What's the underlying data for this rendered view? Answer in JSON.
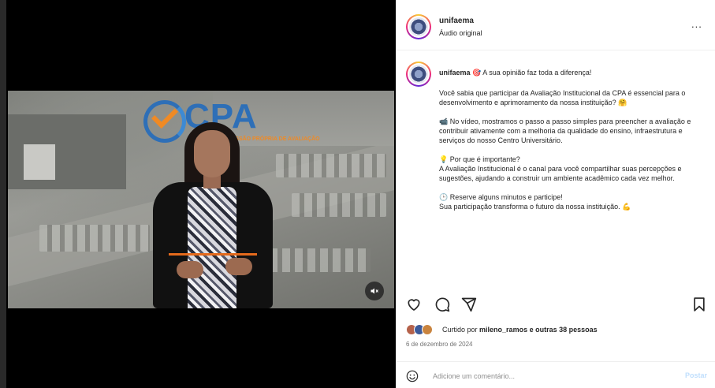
{
  "header": {
    "username": "unifaema",
    "audio": "Áudio original",
    "more": "..."
  },
  "media": {
    "logo_text": "CPA",
    "logo_sub": "COMISSÃO PRÓPRIA DE AVALIAÇÃO"
  },
  "caption": {
    "username": "unifaema",
    "emoji": "🎯",
    "headline": "A sua opinião faz toda a diferença!",
    "paragraphs": [
      "Você sabia que participar da Avaliação Institucional da CPA é essencial para o desenvolvimento e aprimoramento da nossa instituição? 🤗",
      "📹 No vídeo, mostramos o passo a passo simples para preencher a avaliação e contribuir ativamente com a melhoria da qualidade do ensino, infraestrutura e serviços do nosso Centro Universitário.",
      "💡 Por que é importante?\nA Avaliação Institucional é o canal para você compartilhar suas percepções e sugestões, ajudando a construir um ambiente acadêmico cada vez melhor.",
      "🕒 Reserve alguns minutos e participe!\nSua participação transforma o futuro da nossa instituição. 💪"
    ]
  },
  "actions": {
    "like_icon": "heart-icon",
    "comment_icon": "comment-icon",
    "share_icon": "share-icon",
    "save_icon": "bookmark-icon"
  },
  "likes": {
    "prefix": "Curtido por",
    "user": "mileno_ramos",
    "suffix": "e",
    "others": "outras 38 pessoas"
  },
  "date": "6 de dezembro de 2024",
  "comment": {
    "placeholder": "Adicione um comentário...",
    "post_label": "Postar"
  },
  "colors": {
    "brand_blue": "#2e6fb7",
    "brand_orange": "#f08a24",
    "link": "#0095f6"
  }
}
